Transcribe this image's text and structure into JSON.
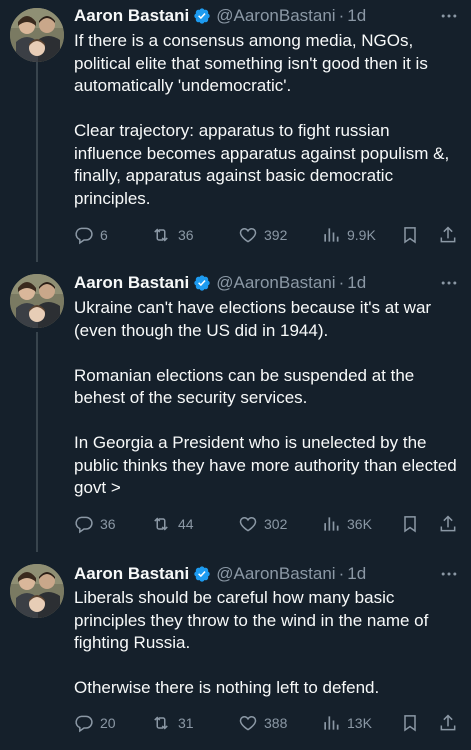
{
  "colors": {
    "background": "#15202b",
    "text": "#f7f9f9",
    "secondary": "#8b98a5",
    "verified": "#1d9bf0",
    "border": "#38444d"
  },
  "tweets": [
    {
      "display_name": "Aaron Bastani",
      "handle": "@AaronBastani",
      "separator": "·",
      "time": "1d",
      "text": "If there is a consensus among media, NGOs, political elite that something isn't good then it is automatically 'undemocratic'.\n\nClear trajectory: apparatus to fight russian influence becomes apparatus against populism &, finally, apparatus against basic democratic principles.",
      "replies": "6",
      "reposts": "36",
      "likes": "392",
      "views": "9.9K"
    },
    {
      "display_name": "Aaron Bastani",
      "handle": "@AaronBastani",
      "separator": "·",
      "time": "1d",
      "text": "Ukraine can't have elections because it's at war (even though the US did in 1944).\n\nRomanian elections can be suspended at the behest of the security services.\n\nIn Georgia a President who is unelected by the public thinks they have more authority than elected govt >",
      "replies": "36",
      "reposts": "44",
      "likes": "302",
      "views": "36K"
    },
    {
      "display_name": "Aaron Bastani",
      "handle": "@AaronBastani",
      "separator": "·",
      "time": "1d",
      "text": "Liberals should be careful how many basic principles they throw to the wind in the name of fighting Russia.\n\nOtherwise there is nothing left to defend.",
      "replies": "20",
      "reposts": "31",
      "likes": "388",
      "views": "13K"
    }
  ],
  "icons": {
    "verified": "verified-badge-icon",
    "more": "more-horizontal-icon",
    "reply": "reply-icon",
    "repost": "repost-icon",
    "like": "heart-icon",
    "views": "views-chart-icon",
    "bookmark": "bookmark-icon",
    "share": "share-icon"
  }
}
